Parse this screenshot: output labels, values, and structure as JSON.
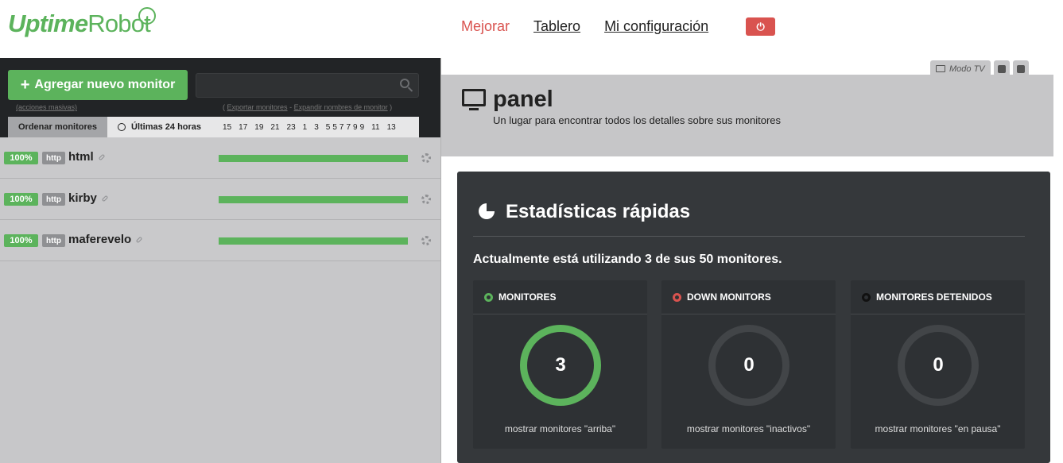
{
  "header": {
    "logo_text_a": "Uptime",
    "logo_text_b": "Robot",
    "nav": {
      "upgrade": "Mejorar",
      "dashboard": "Tablero",
      "settings": "Mi configuración"
    },
    "power_symbol": "⏻"
  },
  "sidebar": {
    "add_button": "Agregar nuevo monitor",
    "add_symbol": "+",
    "search_placeholder": "",
    "mass_actions": "(acciones masivas)",
    "export_open": "(",
    "export_link": "Exportar monitores",
    "export_sep": "-",
    "expand_link": "Expandir nombres de monitor",
    "export_close": ")",
    "sort_tab": "Ordenar monitores",
    "hours_tab": "Últimas 24 horas",
    "hour_labels": [
      "15",
      "17",
      "19",
      "21",
      "23",
      "1",
      "3",
      "5",
      "5",
      "7",
      "7",
      "9",
      "9",
      "11",
      "13"
    ],
    "monitors": [
      {
        "uptime": "100%",
        "type": "http",
        "name": "html",
        "status_color": "#5cb35c"
      },
      {
        "uptime": "100%",
        "type": "http",
        "name": "kirby",
        "status_color": "#5cb35c"
      },
      {
        "uptime": "100%",
        "type": "http",
        "name": "maferevelo",
        "status_color": "#5cb35c"
      }
    ]
  },
  "main": {
    "tv_mode": "Modo TV",
    "panel_title": "panel",
    "panel_subtitle": "Un lugar para encontrar todos los detalles sobre sus monitores",
    "stats_title": "Estadísticas rápidas",
    "usage_text": "Actualmente está utilizando 3 de sus 50 monitores.",
    "cards": [
      {
        "title": "MONITORES",
        "value": "3",
        "footer": "mostrar monitores \"arriba\"",
        "dot_color": "#5cb35c",
        "icon": "up-status-icon"
      },
      {
        "title": "DOWN MONITORS",
        "value": "0",
        "footer": "mostrar monitores \"inactivos\"",
        "dot_color": "#d9534f",
        "icon": "down-status-icon"
      },
      {
        "title": "MONITORES DETENIDOS",
        "value": "0",
        "footer": "mostrar monitores \"en pausa\"",
        "dot_color": "#111111",
        "icon": "paused-status-icon"
      }
    ]
  },
  "colors": {
    "brand_green": "#5cb35c",
    "danger_red": "#d9534f",
    "dark_panel": "#35383b"
  }
}
